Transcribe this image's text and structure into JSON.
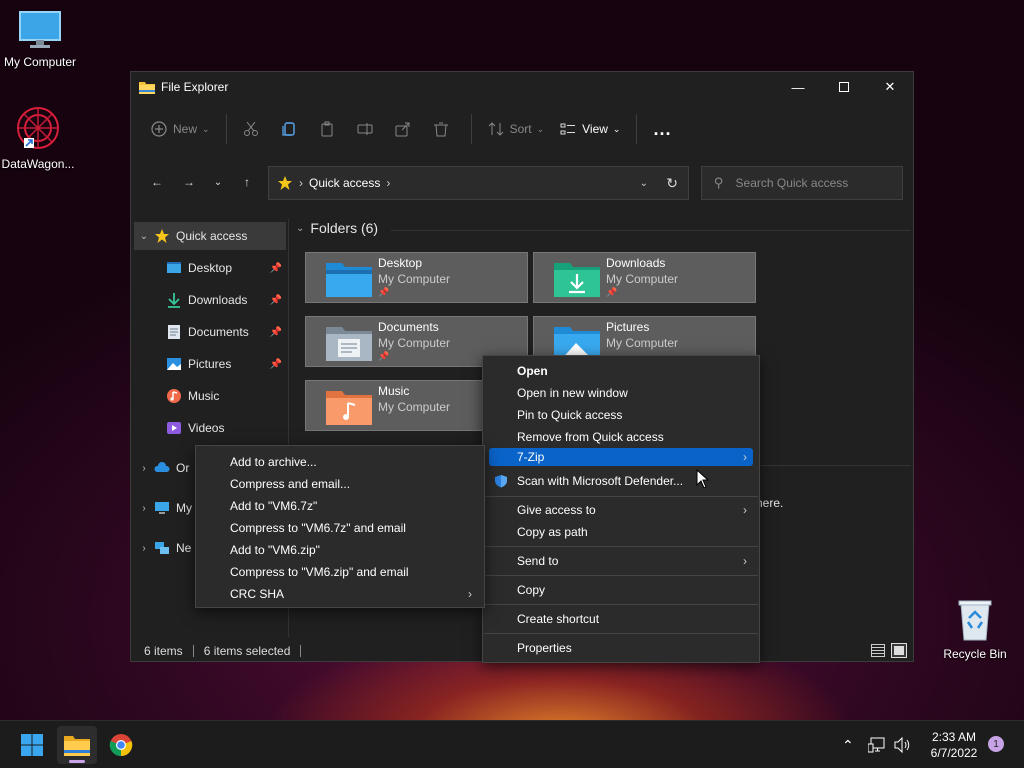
{
  "desktop": {
    "icons": [
      {
        "label": "My Computer"
      },
      {
        "label": "DataWagon..."
      },
      {
        "label": "Recycle Bin"
      }
    ]
  },
  "window": {
    "title": "File Explorer",
    "toolbar": {
      "new_label": "New",
      "sort_label": "Sort",
      "view_label": "View",
      "more_label": "..."
    },
    "address": {
      "crumb": "Quick access",
      "separator": "›"
    },
    "search": {
      "placeholder": "Search Quick access"
    },
    "sidebar": {
      "items": [
        {
          "label": "Quick access"
        },
        {
          "label": "Desktop"
        },
        {
          "label": "Downloads"
        },
        {
          "label": "Documents"
        },
        {
          "label": "Pictures"
        },
        {
          "label": "Music"
        },
        {
          "label": "Videos"
        },
        {
          "label": "Or"
        },
        {
          "label": "My"
        },
        {
          "label": "Ne"
        }
      ]
    },
    "content": {
      "section_title": "Folders (6)",
      "folders": [
        {
          "name": "Desktop",
          "location": "My Computer"
        },
        {
          "name": "Downloads",
          "location": "My Computer"
        },
        {
          "name": "Documents",
          "location": "My Computer"
        },
        {
          "name": "Pictures",
          "location": "My Computer"
        },
        {
          "name": "Music",
          "location": "My Computer"
        }
      ],
      "partial_text": "here."
    },
    "status": {
      "items_count": "6 items",
      "selected_count": "6 items selected"
    }
  },
  "context_menu": {
    "items": [
      {
        "label": "Open"
      },
      {
        "label": "Open in new window"
      },
      {
        "label": "Pin to Quick access"
      },
      {
        "label": "Remove from Quick access"
      },
      {
        "label": "7-Zip"
      },
      {
        "label": "Scan with Microsoft Defender..."
      },
      {
        "label": "Give access to"
      },
      {
        "label": "Copy as path"
      },
      {
        "label": "Send to"
      },
      {
        "label": "Copy"
      },
      {
        "label": "Create shortcut"
      },
      {
        "label": "Properties"
      }
    ],
    "submenu_arrow": "›"
  },
  "zip_submenu": {
    "items": [
      {
        "label": "Add to archive..."
      },
      {
        "label": "Compress and email..."
      },
      {
        "label": "Add to \"VM6.7z\""
      },
      {
        "label": "Compress to \"VM6.7z\" and email"
      },
      {
        "label": "Add to \"VM6.zip\""
      },
      {
        "label": "Compress to \"VM6.zip\" and email"
      },
      {
        "label": "CRC SHA"
      }
    ]
  },
  "taskbar": {
    "time": "2:33 AM",
    "date": "6/7/2022",
    "notification_count": "1"
  },
  "colors": {
    "accent": "#0a63c9",
    "window_bg": "#202020",
    "tile_bg": "#5d5d5d"
  }
}
